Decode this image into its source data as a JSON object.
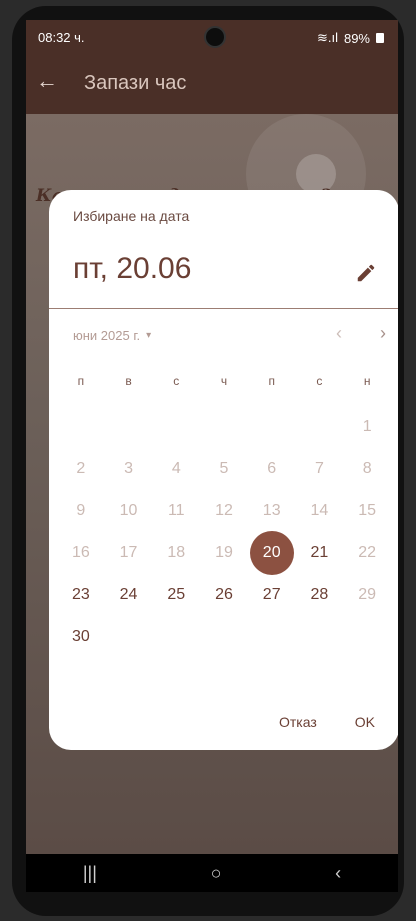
{
  "status_bar": {
    "time": "08:32 ч.",
    "signal_text": "≋.ıl",
    "battery": "89%"
  },
  "app_bar": {
    "title": "Запази час",
    "back_icon": "arrow-left-icon"
  },
  "background": {
    "heading": "Каква процедура желаете?"
  },
  "dialog": {
    "title": "Избиране на дата",
    "selected_date": "пт, 20.06",
    "edit_icon": "pencil-icon",
    "month_label": "юни 2025 г.",
    "month_caret": "▾",
    "prev_label": "‹",
    "next_label": "›",
    "weekdays": [
      "п",
      "в",
      "с",
      "ч",
      "п",
      "с",
      "н"
    ],
    "days": [
      {
        "label": "",
        "state": "blank"
      },
      {
        "label": "",
        "state": "blank"
      },
      {
        "label": "",
        "state": "blank"
      },
      {
        "label": "",
        "state": "blank"
      },
      {
        "label": "",
        "state": "blank"
      },
      {
        "label": "",
        "state": "blank"
      },
      {
        "label": "1",
        "state": "disabled"
      },
      {
        "label": "2",
        "state": "disabled"
      },
      {
        "label": "3",
        "state": "disabled"
      },
      {
        "label": "4",
        "state": "disabled"
      },
      {
        "label": "5",
        "state": "disabled"
      },
      {
        "label": "6",
        "state": "disabled"
      },
      {
        "label": "7",
        "state": "disabled"
      },
      {
        "label": "8",
        "state": "disabled"
      },
      {
        "label": "9",
        "state": "disabled"
      },
      {
        "label": "10",
        "state": "disabled"
      },
      {
        "label": "11",
        "state": "disabled"
      },
      {
        "label": "12",
        "state": "disabled"
      },
      {
        "label": "13",
        "state": "disabled"
      },
      {
        "label": "14",
        "state": "disabled"
      },
      {
        "label": "15",
        "state": "disabled"
      },
      {
        "label": "16",
        "state": "disabled"
      },
      {
        "label": "17",
        "state": "disabled"
      },
      {
        "label": "18",
        "state": "disabled"
      },
      {
        "label": "19",
        "state": "disabled"
      },
      {
        "label": "20",
        "state": "selected"
      },
      {
        "label": "21",
        "state": "enabled"
      },
      {
        "label": "22",
        "state": "disabled"
      },
      {
        "label": "23",
        "state": "enabled"
      },
      {
        "label": "24",
        "state": "enabled"
      },
      {
        "label": "25",
        "state": "enabled"
      },
      {
        "label": "26",
        "state": "enabled"
      },
      {
        "label": "27",
        "state": "enabled"
      },
      {
        "label": "28",
        "state": "enabled"
      },
      {
        "label": "29",
        "state": "disabled"
      },
      {
        "label": "30",
        "state": "enabled"
      }
    ],
    "cancel_label": "Отказ",
    "ok_label": "OK"
  },
  "system_nav": {
    "recent": "|||",
    "home": "○",
    "back": "‹"
  },
  "colors": {
    "accent": "#8c5141",
    "app_bar": "#4a2f27"
  }
}
